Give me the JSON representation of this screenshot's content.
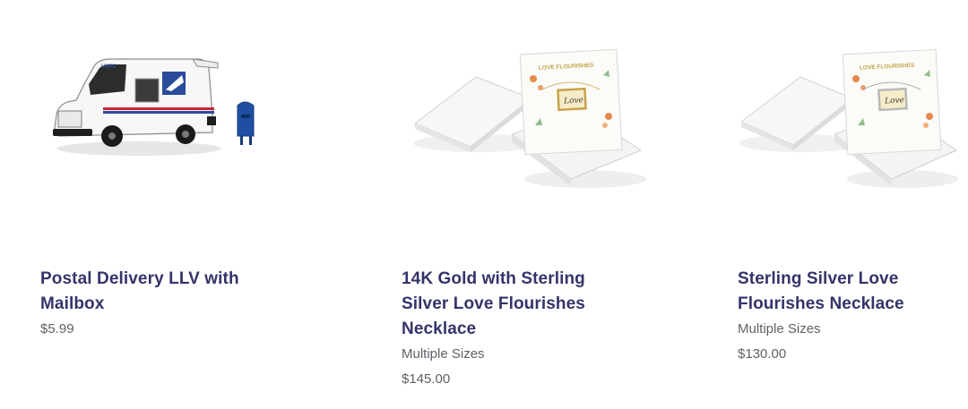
{
  "products": [
    {
      "title": "Postal Delivery LLV with Mailbox",
      "price": "$5.99"
    },
    {
      "title": "14K Gold with Sterling Silver Love Flourishes Necklace",
      "sizes": "Multiple Sizes",
      "price": "$145.00",
      "packaging_text": "LOVE FLOURISHES",
      "pendant_text": "Love"
    },
    {
      "title": "Sterling Silver Love Flourishes Necklace",
      "sizes": "Multiple Sizes",
      "price": "$130.00",
      "packaging_text": "LOVE FLOURISHES",
      "pendant_text": "Love"
    }
  ],
  "colors": {
    "title": "#34346b",
    "meta": "#5f5f66",
    "usps_blue": "#2b4c9b",
    "usps_red": "#c8273a"
  },
  "truck_side_text": "USPS"
}
